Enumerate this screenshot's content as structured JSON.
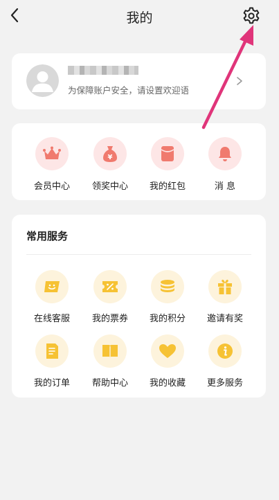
{
  "header": {
    "title": "我的"
  },
  "profile": {
    "hint": "为保障账户安全，请设置欢迎语"
  },
  "quick_actions": [
    {
      "label": "会员中心",
      "icon": "crown-icon"
    },
    {
      "label": "领奖中心",
      "icon": "money-bag-icon"
    },
    {
      "label": "我的红包",
      "icon": "red-packet-icon"
    },
    {
      "label": "消 息",
      "icon": "bell-icon"
    }
  ],
  "services": {
    "title": "常用服务",
    "items": [
      {
        "label": "在线客服",
        "icon": "customer-service-icon"
      },
      {
        "label": "我的票券",
        "icon": "coupon-icon"
      },
      {
        "label": "我的积分",
        "icon": "points-coin-icon"
      },
      {
        "label": "邀请有奖",
        "icon": "gift-icon"
      },
      {
        "label": "我的订单",
        "icon": "order-document-icon"
      },
      {
        "label": "帮助中心",
        "icon": "help-book-icon"
      },
      {
        "label": "我的收藏",
        "icon": "heart-icon"
      },
      {
        "label": "更多服务",
        "icon": "info-icon"
      }
    ]
  },
  "colors": {
    "quick_icon": "#f07a6e",
    "quick_circle_bg": "#fde6e6",
    "service_icon": "#f6c234",
    "service_circle_bg": "#fdf3dc",
    "annotation_arrow": "#e0357a"
  }
}
